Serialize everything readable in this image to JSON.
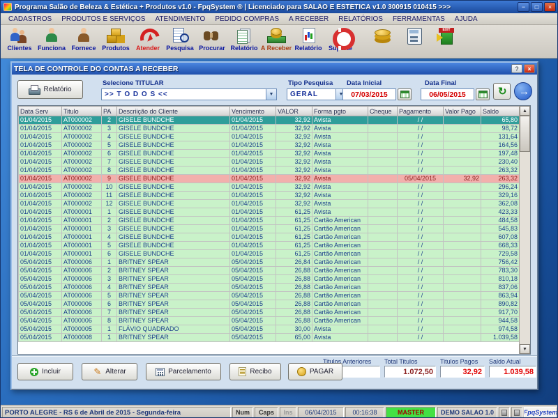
{
  "window": {
    "title": "Programa Salão de Beleza & Estética + Produtos v1.0 - FpqSystem ® | Licenciado para  SALÃO E ESTÉTICA v1.0 300915 010415 >>>",
    "buttons": [
      {
        "name": "minimize-button",
        "glyph": "−"
      },
      {
        "name": "maximize-button",
        "glyph": "□"
      },
      {
        "name": "close-button",
        "glyph": "×"
      }
    ]
  },
  "menu": {
    "items": [
      "CADASTROS",
      "PRODUTOS E SERVIÇOS",
      "ATENDIMENTO",
      "PEDIDO COMPRAS",
      "A RECEBER",
      "RELATÓRIOS",
      "FERRAMENTAS",
      "AJUDA"
    ]
  },
  "toolbar": {
    "buttons": [
      {
        "label": "Clientes",
        "icon": "clients-icon"
      },
      {
        "label": "Funciona",
        "icon": "employee-icon"
      },
      {
        "label": "Fornece",
        "icon": "supplier-icon"
      },
      {
        "label": "Produtos",
        "icon": "products-icon"
      },
      {
        "label": "Atender",
        "icon": "attend-icon",
        "color": "#d81818"
      },
      {
        "label": "Pesquisa",
        "icon": "search-doc-icon"
      },
      {
        "label": "Procurar",
        "icon": "find-icon"
      },
      {
        "label": "Relatório",
        "icon": "report-icon"
      },
      {
        "label": "A Receber",
        "icon": "receivables-icon",
        "color": "#a83c10"
      },
      {
        "label": "Relatório",
        "icon": "report2-icon"
      },
      {
        "label": "Suporte",
        "icon": "support-icon"
      },
      {
        "label": "",
        "icon": "coins-icon"
      },
      {
        "label": "",
        "icon": "calculator-icon"
      },
      {
        "label": "",
        "icon": "exit-icon",
        "badge": "EXIT"
      }
    ]
  },
  "dialog": {
    "title": "TELA DE CONTROLE DO CONTAS A RECEBER",
    "buttons": [
      {
        "name": "help-button",
        "glyph": "?"
      },
      {
        "name": "close-button",
        "glyph": "×"
      }
    ]
  },
  "filters": {
    "report_button": "Relatório",
    "titular_label": "Selecione TITULAR",
    "titular_value": ">> T O D O S <<",
    "tipo_label": "Tipo  Pesquisa",
    "tipo_value": "GERAL",
    "start_label": "Data Inicial",
    "start_value": "07/03/2015",
    "end_label": "Data Final",
    "end_value": "06/05/2015"
  },
  "icons": {
    "arrow_down": "▼",
    "arrow_up": "▲",
    "refresh": "↻",
    "go": "→"
  },
  "grid": {
    "columns": [
      "Data Serv",
      "Titulo",
      "PA",
      "Descriição do Cliente",
      "Vencimento",
      "VALOR",
      "Forma pgto",
      "Cheque",
      "Pagamento",
      "Valor Pago",
      "Saldo"
    ],
    "rows": [
      {
        "state": "selected",
        "cells": [
          "01/04/2015",
          "AT000002",
          "2",
          "GISELE BUNDCHE",
          "01/04/2015",
          "32,92",
          "Avista",
          "",
          "/ /",
          "",
          "65,80"
        ]
      },
      {
        "cells": [
          "01/04/2015",
          "AT000002",
          "3",
          "GISELE BUNDCHE",
          "01/04/2015",
          "32,92",
          "Avista",
          "",
          "/ /",
          "",
          "98,72"
        ]
      },
      {
        "cells": [
          "01/04/2015",
          "AT000002",
          "4",
          "GISELE BUNDCHE",
          "01/04/2015",
          "32,92",
          "Avista",
          "",
          "/ /",
          "",
          "131,64"
        ]
      },
      {
        "cells": [
          "01/04/2015",
          "AT000002",
          "5",
          "GISELE BUNDCHE",
          "01/04/2015",
          "32,92",
          "Avista",
          "",
          "/ /",
          "",
          "164,56"
        ]
      },
      {
        "cells": [
          "01/04/2015",
          "AT000002",
          "6",
          "GISELE BUNDCHE",
          "01/04/2015",
          "32,92",
          "Avista",
          "",
          "/ /",
          "",
          "197,48"
        ]
      },
      {
        "cells": [
          "01/04/2015",
          "AT000002",
          "7",
          "GISELE BUNDCHE",
          "01/04/2015",
          "32,92",
          "Avista",
          "",
          "/ /",
          "",
          "230,40"
        ]
      },
      {
        "cells": [
          "01/04/2015",
          "AT000002",
          "8",
          "GISELE BUNDCHE",
          "01/04/2015",
          "32,92",
          "Avista",
          "",
          "/ /",
          "",
          "263,32"
        ]
      },
      {
        "state": "paid",
        "cells": [
          "01/04/2015",
          "AT000002",
          "9",
          "GISELE BUNDCHE",
          "01/04/2015",
          "32,92",
          "Avista",
          "",
          "05/04/2015",
          "32,92",
          "263,32"
        ]
      },
      {
        "cells": [
          "01/04/2015",
          "AT000002",
          "10",
          "GISELE BUNDCHE",
          "01/04/2015",
          "32,92",
          "Avista",
          "",
          "/ /",
          "",
          "296,24"
        ]
      },
      {
        "cells": [
          "01/04/2015",
          "AT000002",
          "11",
          "GISELE BUNDCHE",
          "01/04/2015",
          "32,92",
          "Avista",
          "",
          "/ /",
          "",
          "329,16"
        ]
      },
      {
        "cells": [
          "01/04/2015",
          "AT000002",
          "12",
          "GISELE BUNDCHE",
          "01/04/2015",
          "32,92",
          "Avista",
          "",
          "/ /",
          "",
          "362,08"
        ]
      },
      {
        "cells": [
          "01/04/2015",
          "AT000001",
          "1",
          "GISELE BUNDCHE",
          "01/04/2015",
          "61,25",
          "Avista",
          "",
          "/ /",
          "",
          "423,33"
        ]
      },
      {
        "cells": [
          "01/04/2015",
          "AT000001",
          "2",
          "GISELE BUNDCHE",
          "01/04/2015",
          "61,25",
          "Cartão American",
          "",
          "/ /",
          "",
          "484,58"
        ]
      },
      {
        "cells": [
          "01/04/2015",
          "AT000001",
          "3",
          "GISELE BUNDCHE",
          "01/04/2015",
          "61,25",
          "Cartão American",
          "",
          "/ /",
          "",
          "545,83"
        ]
      },
      {
        "cells": [
          "01/04/2015",
          "AT000001",
          "4",
          "GISELE BUNDCHE",
          "01/04/2015",
          "61,25",
          "Cartão American",
          "",
          "/ /",
          "",
          "607,08"
        ]
      },
      {
        "cells": [
          "01/04/2015",
          "AT000001",
          "5",
          "GISELE BUNDCHE",
          "01/04/2015",
          "61,25",
          "Cartão American",
          "",
          "/ /",
          "",
          "668,33"
        ]
      },
      {
        "cells": [
          "01/04/2015",
          "AT000001",
          "6",
          "GISELE BUNDCHE",
          "01/04/2015",
          "61,25",
          "Cartão American",
          "",
          "/ /",
          "",
          "729,58"
        ]
      },
      {
        "cells": [
          "05/04/2015",
          "AT000006",
          "1",
          "BRITNEY SPEAR",
          "05/04/2015",
          "26,84",
          "Cartão American",
          "",
          "/ /",
          "",
          "756,42"
        ]
      },
      {
        "cells": [
          "05/04/2015",
          "AT000006",
          "2",
          "BRITNEY SPEAR",
          "05/04/2015",
          "26,88",
          "Cartão American",
          "",
          "/ /",
          "",
          "783,30"
        ]
      },
      {
        "cells": [
          "05/04/2015",
          "AT000006",
          "3",
          "BRITNEY SPEAR",
          "05/04/2015",
          "26,88",
          "Cartão American",
          "",
          "/ /",
          "",
          "810,18"
        ]
      },
      {
        "cells": [
          "05/04/2015",
          "AT000006",
          "4",
          "BRITNEY SPEAR",
          "05/04/2015",
          "26,88",
          "Cartão American",
          "",
          "/ /",
          "",
          "837,06"
        ]
      },
      {
        "cells": [
          "05/04/2015",
          "AT000006",
          "5",
          "BRITNEY SPEAR",
          "05/04/2015",
          "26,88",
          "Cartão American",
          "",
          "/ /",
          "",
          "863,94"
        ]
      },
      {
        "cells": [
          "05/04/2015",
          "AT000006",
          "6",
          "BRITNEY SPEAR",
          "05/04/2015",
          "26,88",
          "Cartão American",
          "",
          "/ /",
          "",
          "890,82"
        ]
      },
      {
        "cells": [
          "05/04/2015",
          "AT000006",
          "7",
          "BRITNEY SPEAR",
          "05/04/2015",
          "26,88",
          "Cartão American",
          "",
          "/ /",
          "",
          "917,70"
        ]
      },
      {
        "cells": [
          "05/04/2015",
          "AT000006",
          "8",
          "BRITNEY SPEAR",
          "05/04/2015",
          "26,88",
          "Cartão American",
          "",
          "/ /",
          "",
          "944,58"
        ]
      },
      {
        "cells": [
          "05/04/2015",
          "AT000005",
          "1",
          "FLÁVIO QUADRADO",
          "05/04/2015",
          "30,00",
          "Avista",
          "",
          "/ /",
          "",
          "974,58"
        ]
      },
      {
        "cells": [
          "05/04/2015",
          "AT000008",
          "1",
          "BRITNEY SPEAR",
          "05/04/2015",
          "65,00",
          "Avista",
          "",
          "/ /",
          "",
          "1.039,58"
        ]
      }
    ]
  },
  "actions": [
    {
      "label": "Incluir",
      "icon": "add-icon"
    },
    {
      "label": "Alterar",
      "icon": "edit-icon"
    },
    {
      "label": "Parcelamento",
      "icon": "installments-icon"
    },
    {
      "label": "Recibo",
      "icon": "receipt-icon"
    },
    {
      "label": "PAGAR",
      "icon": "pay-icon"
    }
  ],
  "totals": {
    "previous_label": "Titulos Anteriores",
    "previous_value": "",
    "total_label": "Total Titulos",
    "total_value": "1.072,50",
    "paid_label": "Titulos Pagos",
    "paid_value": "32,92",
    "balance_label": "Saldo Atual",
    "balance_value": "1.039,58"
  },
  "statusbar": {
    "location": "PORTO ALEGRE - RS  6 de Abril de 2015 - Segunda-feira",
    "num": "Num",
    "caps": "Caps",
    "ins": "Ins",
    "date": "06/04/2015",
    "time": "00:16:38",
    "user": "MASTER",
    "license": "DEMO SALAO 1.0",
    "brand": "FpqSystem"
  }
}
